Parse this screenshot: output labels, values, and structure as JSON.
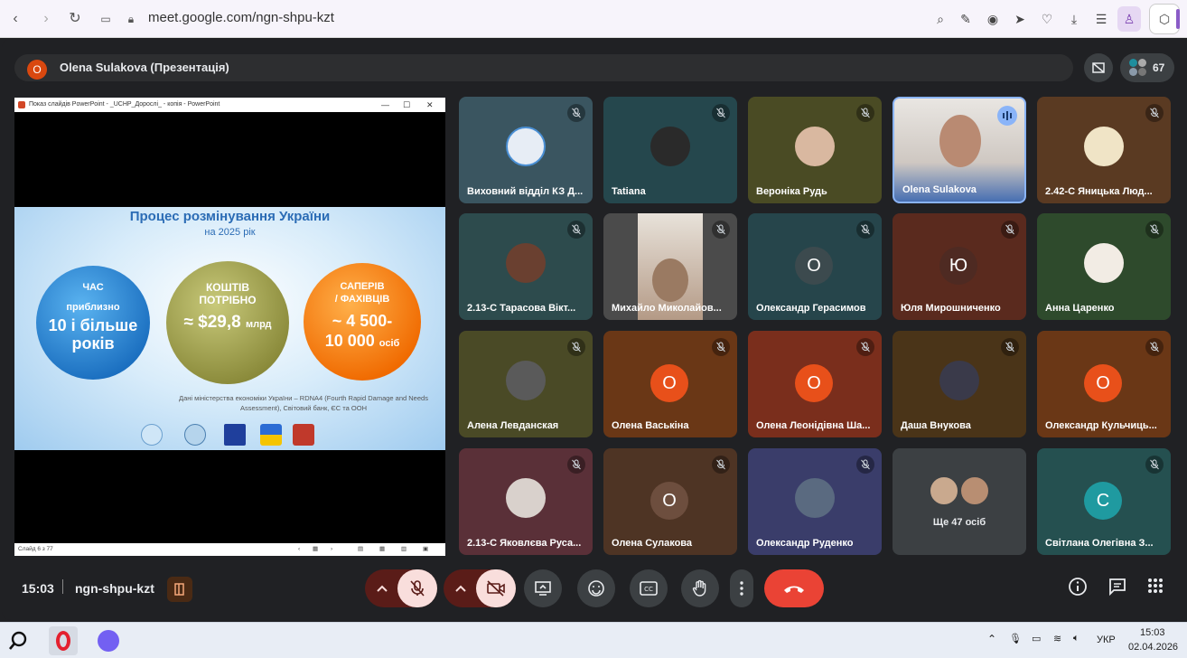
{
  "browser": {
    "url": "meet.google.com/ngn-shpu-kzt"
  },
  "meeting": {
    "presenter_avatar": "O",
    "presenter_label": "Olena Sulakova (Презентація)",
    "participant_count": "67",
    "clock": "15:03",
    "code": "ngn-shpu-kzt"
  },
  "presentation": {
    "window_title": "Показ слайдів PowerPoint - _UCHP_Дорослі_ - копія - PowerPoint",
    "slide_title": "Процес розмінування України",
    "slide_subtitle": "на 2025 рік",
    "blue": {
      "label": "ЧАС",
      "line1": "приблизно",
      "line2": "10 і більше",
      "line3": "років"
    },
    "green": {
      "label1": "КОШТІВ",
      "label2": "ПОТРІБНО",
      "value": "≈ $29,8",
      "unit": "млрд"
    },
    "orange": {
      "label1": "САПЕРІВ",
      "label2": "/ ФАХІВЦІВ",
      "line1": "~ 4 500-",
      "line2": "10 000",
      "unit": "осіб"
    },
    "note": "Дані міністерства економіки України – RDNA4 (Fourth Rapid Damage and Needs Assessment), Світовий банк, ЄС та ООН",
    "status": "Слайд 6 з 77"
  },
  "tiles": [
    {
      "name": "Виховний відділ КЗ Д...",
      "avatar": "",
      "color": "#3a5560"
    },
    {
      "name": "Tatiana",
      "avatar": "",
      "color": "#25474d"
    },
    {
      "name": "Вероніка Рудь",
      "avatar": "",
      "color": "#4a4b24"
    },
    {
      "name": "Olena Sulakova",
      "avatar": "",
      "color": "#d8d2cc"
    },
    {
      "name": "2.42-С Яницька Люд...",
      "avatar": "",
      "color": "#5a3a22"
    },
    {
      "name": "2.13-С Тарасова Вікт...",
      "avatar": "",
      "color": "#2d4b4d"
    },
    {
      "name": "Михайло Миколайов...",
      "avatar": "",
      "color": "#4b4b4b"
    },
    {
      "name": "Олександр Герасимов",
      "avatar": "О",
      "color": "#26454b"
    },
    {
      "name": "Юля Мирошниченко",
      "avatar": "Ю",
      "color": "#5a2a1e"
    },
    {
      "name": "Анна Царенко",
      "avatar": "",
      "color": "#2e4a2c"
    },
    {
      "name": "Алена Левданская",
      "avatar": "",
      "color": "#4a4a26"
    },
    {
      "name": "Олена Васькіна",
      "avatar": "О",
      "color": "#6a3716"
    },
    {
      "name": "Олена Леонідівна Ша...",
      "avatar": "О",
      "color": "#7a2e1c"
    },
    {
      "name": "Даша Внукова",
      "avatar": "",
      "color": "#4a3418"
    },
    {
      "name": "Олександр Кульчиць...",
      "avatar": "О",
      "color": "#6a3716"
    },
    {
      "name": "2.13-С Яковлєва Руса...",
      "avatar": "",
      "color": "#5a3038"
    },
    {
      "name": "Олена Сулакова",
      "avatar": "О",
      "color": "#4e3424"
    },
    {
      "name": "Олександр Руденко",
      "avatar": "",
      "color": "#3a3d6a"
    },
    {
      "name": "Ще 47 осіб",
      "avatar": "",
      "color": "#3c4043"
    },
    {
      "name": "Світлана Олегівна З...",
      "avatar": "С",
      "color": "#255050"
    }
  ],
  "taskbar": {
    "time": "15:03",
    "date": "02.04.2026",
    "lang": "УКР"
  },
  "colors": {
    "meet_bg": "#202124",
    "end_call": "#ea4335",
    "mic_off_bg": "#f9dedc",
    "orange_avatar": "#e8501a"
  }
}
